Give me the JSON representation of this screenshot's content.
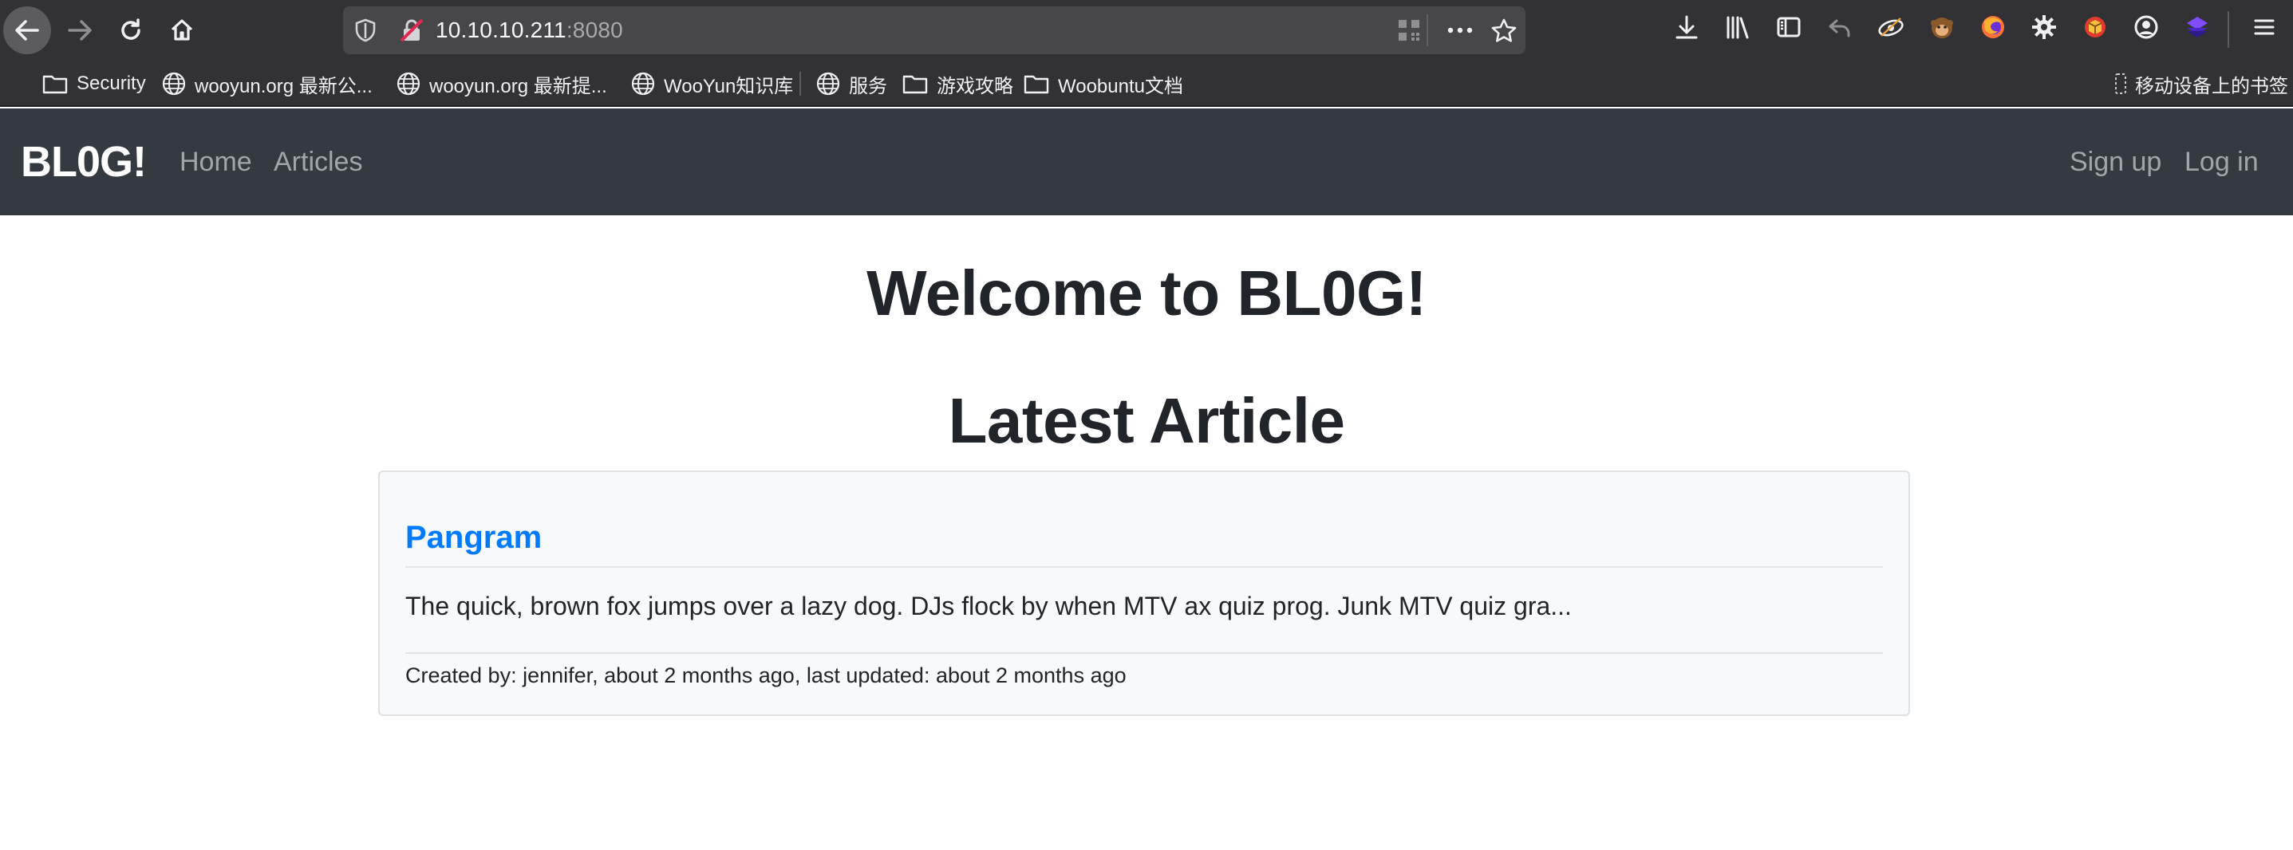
{
  "browser": {
    "url_host": "10.10.10.211",
    "url_port": ":8080",
    "bookmarks": [
      {
        "label": "Security",
        "icon": "folder-icon"
      },
      {
        "label": "wooyun.org 最新公...",
        "icon": "globe-icon"
      },
      {
        "label": "wooyun.org 最新提...",
        "icon": "globe-icon"
      },
      {
        "label": "WooYun知识库",
        "icon": "globe-icon"
      },
      {
        "label": "服务",
        "icon": "globe-icon"
      },
      {
        "label": "游戏攻略",
        "icon": "folder-icon"
      },
      {
        "label": "Woobuntu文档",
        "icon": "folder-icon"
      }
    ],
    "mobile_bookmarks": "移动设备上的书签"
  },
  "site": {
    "brand": "BL0G!",
    "nav_left": [
      "Home",
      "Articles"
    ],
    "nav_right": [
      "Sign up",
      "Log in"
    ]
  },
  "main": {
    "welcome": "Welcome to BL0G!",
    "latest_heading": "Latest Article",
    "article": {
      "title": "Pangram",
      "excerpt": "The quick, brown fox jumps over a lazy dog. DJs flock by when MTV ax quiz prog. Junk MTV quiz gra...",
      "meta": "Created by: jennifer, about 2 months ago, last updated: about 2 months ago"
    }
  },
  "colors": {
    "navbar_bg": "#343a40",
    "link_blue": "#007bff",
    "card_bg": "#f8f9fa"
  }
}
